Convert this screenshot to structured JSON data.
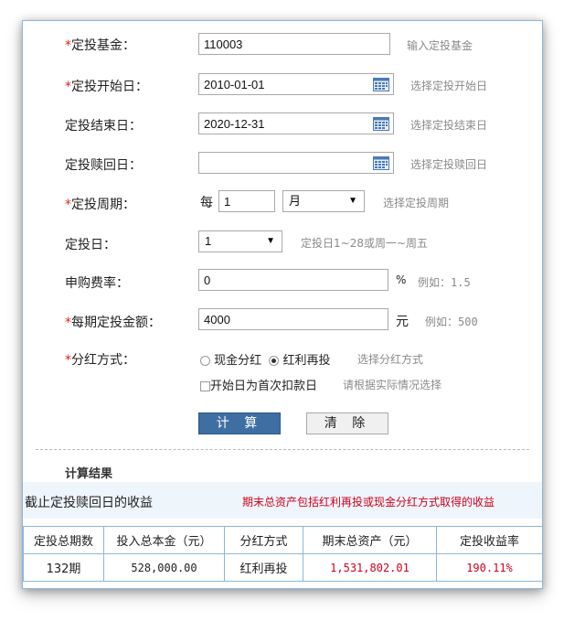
{
  "form": {
    "fund": {
      "label": "定投基金：",
      "value": "110003",
      "hint": "输入定投基金"
    },
    "start_date": {
      "label": "定投开始日：",
      "value": "2010-01-01",
      "hint": "选择定投开始日"
    },
    "end_date": {
      "label": "定投结束日：",
      "value": "2020-12-31",
      "hint": "选择定投结束日"
    },
    "redeem_date": {
      "label": "定投赎回日：",
      "value": "",
      "hint": "选择定投赎回日"
    },
    "period": {
      "label": "定投周期：",
      "prefix": "每",
      "value": "1",
      "unit_selected": "月",
      "hint": "选择定投周期"
    },
    "invest_day": {
      "label": "定投日：",
      "selected": "1",
      "hint": "定投日1~28或周一~周五"
    },
    "fee_rate": {
      "label": "申购费率：",
      "value": "0",
      "unit": "%",
      "hint": "例如：1.5"
    },
    "amount": {
      "label": "每期定投金额：",
      "value": "4000",
      "unit": "元",
      "hint": "例如：500"
    },
    "dividend": {
      "label": "分红方式：",
      "options": [
        "现金分红",
        "红利再投"
      ],
      "selected": "红利再投",
      "hint": "选择分红方式"
    },
    "first_deduct": {
      "label": "开始日为首次扣款日",
      "checked": false,
      "hint": "请根据实际情况选择"
    },
    "required_mark": "*"
  },
  "buttons": {
    "calculate": "计 算",
    "clear": "清 除"
  },
  "results": {
    "title": "计算结果",
    "subtitle": "截止定投赎回日的收益",
    "note": "期末总资产包括红利再投或现金分红方式取得的收益",
    "columns": [
      "定投总期数",
      "投入总本金（元）",
      "分红方式",
      "期末总资产（元）",
      "定投收益率"
    ],
    "row": [
      "132期",
      "528,000.00",
      "红利再投",
      "1,531,802.01",
      "190.11%"
    ]
  },
  "colors": {
    "accent": "#3f6fa2",
    "required": "#e0201b",
    "result_red": "#d0021b",
    "border": "#8fb6d8"
  }
}
